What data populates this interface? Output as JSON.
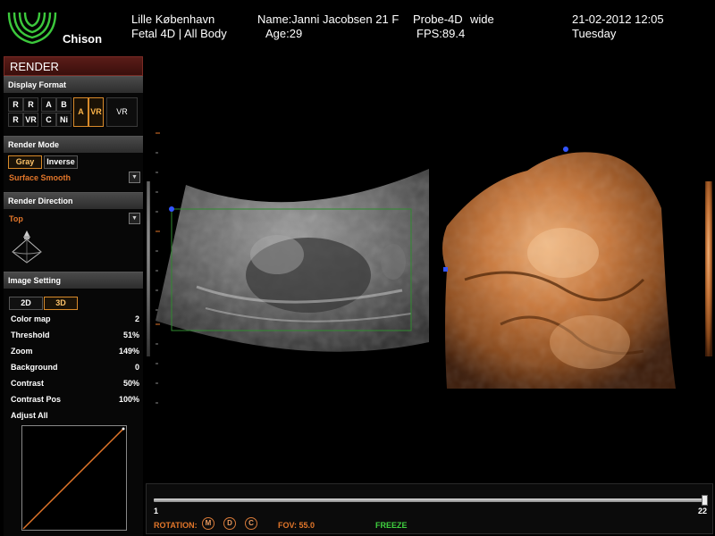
{
  "header": {
    "brand": "Chison",
    "location": "Lille København",
    "exam": "Fetal 4D | All Body",
    "patient_name": "Name:Janni Jacobsen 21 F",
    "age": "Age:29",
    "probe": "Probe-4D",
    "probe_mode": "wide",
    "fps": "FPS:89.4",
    "date_time": "21-02-2012  12:05",
    "weekday": "Tuesday"
  },
  "panel": {
    "title": "RENDER",
    "display_format": {
      "heading": "Display Format",
      "buttons": [
        "R",
        "R",
        "A",
        "B",
        "R",
        "VR",
        "C",
        "Ni",
        "A",
        "VR",
        "VR"
      ]
    },
    "render_mode": {
      "heading": "Render Mode",
      "gray": "Gray",
      "inverse": "Inverse",
      "surface": "Surface Smooth"
    },
    "render_direction": {
      "heading": "Render Direction",
      "value": "Top"
    },
    "image_setting": {
      "heading": "Image Setting",
      "btn_2d": "2D",
      "btn_3d": "3D",
      "rows": [
        {
          "label": "Color map",
          "value": "2"
        },
        {
          "label": "Threshold",
          "value": "51%"
        },
        {
          "label": "Zoom",
          "value": "149%"
        },
        {
          "label": "Background",
          "value": "0"
        },
        {
          "label": "Contrast",
          "value": "50%"
        },
        {
          "label": "Contrast Pos",
          "value": "100%"
        }
      ],
      "adjust_all": "Adjust All"
    }
  },
  "bottom": {
    "slider_min": "1",
    "slider_max": "22",
    "slider_position": 1.0,
    "rotation_label": "ROTATION:",
    "rotation_icons": [
      "M",
      "D",
      "C"
    ],
    "fov": "FOV: 55.0",
    "status": "FREEZE"
  },
  "colors": {
    "accent_orange": "#e2762a",
    "freeze_green": "#3fd03f",
    "render_header": "#5a1c18",
    "logo_green": "#3cc83c"
  }
}
